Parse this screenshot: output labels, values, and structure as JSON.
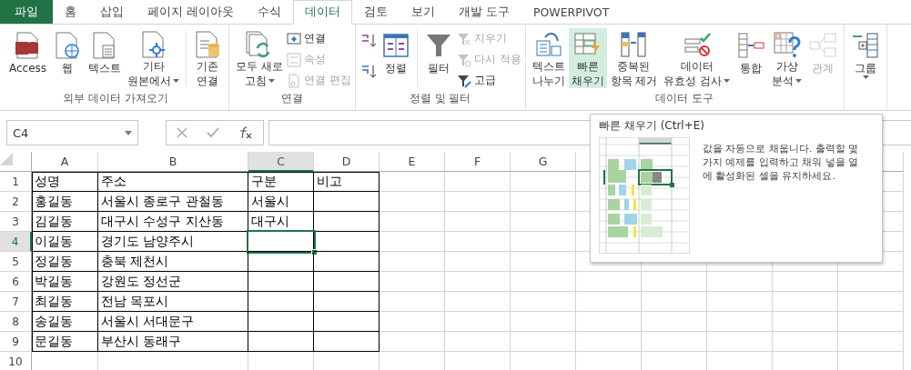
{
  "tabs": [
    {
      "label": "파일",
      "kind": "file",
      "selected": false
    },
    {
      "label": "홈",
      "kind": "tab",
      "selected": false
    },
    {
      "label": "삽입",
      "kind": "tab",
      "selected": false
    },
    {
      "label": "페이지 레이아웃",
      "kind": "tab",
      "selected": false
    },
    {
      "label": "수식",
      "kind": "tab",
      "selected": false
    },
    {
      "label": "데이터",
      "kind": "tab",
      "selected": true
    },
    {
      "label": "검토",
      "kind": "tab",
      "selected": false
    },
    {
      "label": "보기",
      "kind": "tab",
      "selected": false
    },
    {
      "label": "개발 도구",
      "kind": "tab",
      "selected": false
    },
    {
      "label": "POWERPIVOT",
      "kind": "tab",
      "selected": false
    }
  ],
  "ribbon": {
    "groups": [
      {
        "label": "외부 데이터 가져오기",
        "controls": [
          {
            "kind": "large",
            "lines": [
              "Access"
            ],
            "dropdown": false,
            "disabled": false,
            "selected": false
          },
          {
            "kind": "large",
            "lines": [
              "웹"
            ],
            "dropdown": false,
            "disabled": false,
            "selected": false
          },
          {
            "kind": "large",
            "lines": [
              "텍스트"
            ],
            "dropdown": false,
            "disabled": false,
            "selected": false
          },
          {
            "kind": "large",
            "lines": [
              "기타",
              "원본에서"
            ],
            "dropdown": true,
            "disabled": false,
            "selected": false
          },
          {
            "kind": "separator"
          },
          {
            "kind": "large",
            "lines": [
              "기존",
              "연결"
            ],
            "dropdown": false,
            "disabled": false,
            "selected": false
          }
        ]
      },
      {
        "label": "연결",
        "controls": [
          {
            "kind": "large",
            "lines": [
              "모두 새로",
              "고침"
            ],
            "dropdown": true,
            "disabled": false,
            "selected": false
          },
          {
            "kind": "stack",
            "items": [
              {
                "label": "연결",
                "disabled": false
              },
              {
                "label": "속성",
                "disabled": true
              },
              {
                "label": "연결 편집",
                "disabled": true
              }
            ]
          }
        ]
      },
      {
        "label": "정렬 및 필터",
        "controls": [
          {
            "kind": "icon-stack"
          },
          {
            "kind": "large",
            "lines": [
              "정렬"
            ],
            "dropdown": false,
            "disabled": false,
            "selected": false
          },
          {
            "kind": "separator"
          },
          {
            "kind": "large",
            "lines": [
              "필터"
            ],
            "dropdown": false,
            "disabled": false,
            "selected": false
          },
          {
            "kind": "stack",
            "items": [
              {
                "label": "지우기",
                "disabled": true
              },
              {
                "label": "다시 적용",
                "disabled": true
              },
              {
                "label": "고급",
                "disabled": false
              }
            ]
          }
        ]
      },
      {
        "label": "데이터 도구",
        "controls": [
          {
            "kind": "large",
            "lines": [
              "텍스트",
              "나누기"
            ],
            "dropdown": false,
            "disabled": false,
            "selected": false
          },
          {
            "kind": "large",
            "lines": [
              "빠른",
              "채우기"
            ],
            "dropdown": false,
            "disabled": false,
            "selected": true
          },
          {
            "kind": "large",
            "lines": [
              "중복된",
              "항목 제거"
            ],
            "dropdown": false,
            "disabled": false,
            "selected": false
          },
          {
            "kind": "large",
            "lines": [
              "데이터",
              "유효성 검사"
            ],
            "dropdown": true,
            "disabled": false,
            "selected": false
          },
          {
            "kind": "large",
            "lines": [
              "통합"
            ],
            "dropdown": false,
            "disabled": false,
            "selected": false
          },
          {
            "kind": "large",
            "lines": [
              "가상",
              "분석"
            ],
            "dropdown": true,
            "disabled": false,
            "selected": false
          },
          {
            "kind": "large",
            "lines": [
              "관계"
            ],
            "dropdown": false,
            "disabled": true,
            "selected": false
          }
        ]
      },
      {
        "controls": [
          {
            "kind": "large",
            "lines": [
              "그룹"
            ],
            "dropdown": true,
            "disabled": false,
            "selected": false
          }
        ]
      }
    ]
  },
  "formula_bar": {
    "name_box": "C4"
  },
  "sheet": {
    "columns": [
      {
        "label": "A",
        "selected": false
      },
      {
        "label": "B",
        "selected": false
      },
      {
        "label": "C",
        "selected": true
      },
      {
        "label": "D",
        "selected": false
      },
      {
        "label": "E",
        "selected": false
      },
      {
        "label": "F",
        "selected": false
      },
      {
        "label": "G",
        "selected": false
      }
    ],
    "rows": [
      {
        "number": "1",
        "selected": false,
        "cells": [
          "성명",
          "주소",
          "구분",
          "비고"
        ]
      },
      {
        "number": "2",
        "selected": false,
        "cells": [
          "홍길동",
          "서울시 종로구 관철동",
          "서울시"
        ]
      },
      {
        "number": "3",
        "selected": false,
        "cells": [
          "김길동",
          "대구시 수성구 지산동",
          "대구시"
        ]
      },
      {
        "number": "4",
        "selected": true,
        "cells": [
          "이길동",
          "경기도 남양주시"
        ]
      },
      {
        "number": "5",
        "selected": false,
        "cells": [
          "정길동",
          "충북 제천시"
        ]
      },
      {
        "number": "6",
        "selected": false,
        "cells": [
          "박길동",
          "강원도 정선군"
        ]
      },
      {
        "number": "7",
        "selected": false,
        "cells": [
          "최길동",
          "전남 목포시"
        ]
      },
      {
        "number": "8",
        "selected": false,
        "cells": [
          "송길동",
          "서울시 서대문구"
        ]
      },
      {
        "number": "9",
        "selected": false,
        "cells": [
          "문길동",
          "부산시 동래구"
        ]
      },
      {
        "number": "10",
        "selected": false,
        "cells": []
      }
    ]
  },
  "tooltip": {
    "title": "빠른 채우기 (Ctrl+E)",
    "description": "값을 자동으로 채웁니다. 출력할 몇 가지 예제를 입력하고 채워 넣을 열에 활성화된 셀을 유지하세요."
  }
}
